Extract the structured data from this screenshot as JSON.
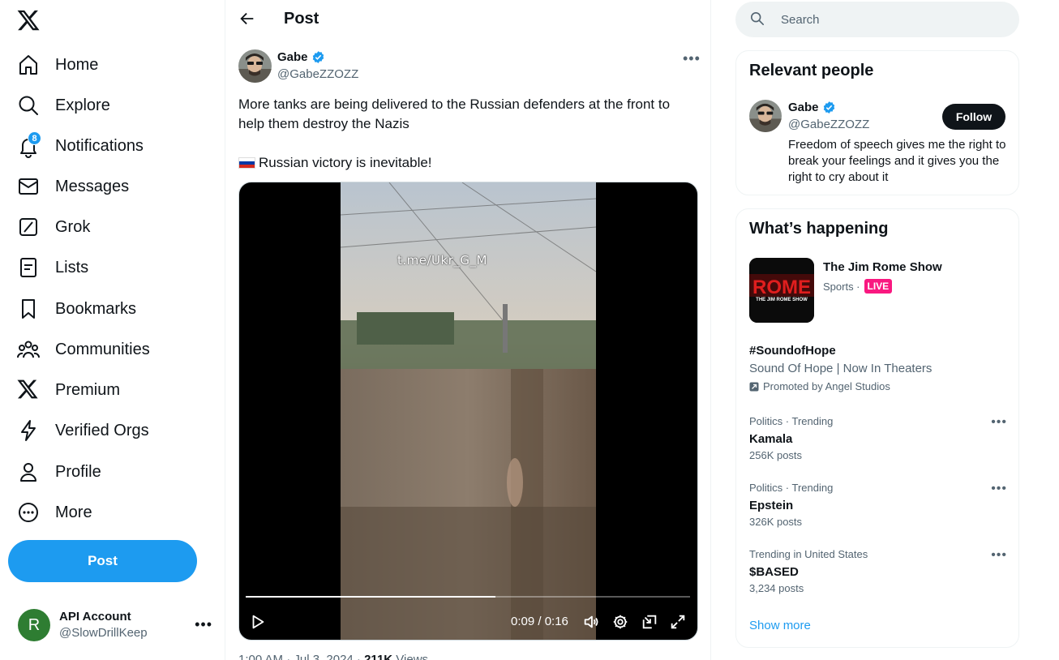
{
  "nav": {
    "logo": "x-logo-icon",
    "items": [
      {
        "label": "Home",
        "icon": "home-icon"
      },
      {
        "label": "Explore",
        "icon": "search-icon"
      },
      {
        "label": "Notifications",
        "icon": "bell-icon",
        "badge": "8"
      },
      {
        "label": "Messages",
        "icon": "mail-icon"
      },
      {
        "label": "Grok",
        "icon": "grok-icon"
      },
      {
        "label": "Lists",
        "icon": "list-icon"
      },
      {
        "label": "Bookmarks",
        "icon": "bookmark-icon"
      },
      {
        "label": "Communities",
        "icon": "people-icon"
      },
      {
        "label": "Premium",
        "icon": "x-logo-icon"
      },
      {
        "label": "Verified Orgs",
        "icon": "lightning-icon"
      },
      {
        "label": "Profile",
        "icon": "person-icon"
      },
      {
        "label": "More",
        "icon": "more-circle-icon"
      }
    ],
    "post_button": "Post",
    "account": {
      "avatar_letter": "R",
      "name": "API Account",
      "handle": "@SlowDrillKeep",
      "avatar_color": "#2e7d32"
    }
  },
  "main": {
    "header_title": "Post",
    "post": {
      "author_name": "Gabe",
      "author_handle": "@GabeZZOZZ",
      "text_line1": "More tanks are being delivered to the Russian defenders at the front to help them destroy the Nazis",
      "text_line2": "Russian victory is inevitable!",
      "video": {
        "watermark": "t.me/Ukr_G_M",
        "time": "0:09 / 0:16",
        "progress": 0.5625
      },
      "timestamp": "1:00 AM · Jul 3, 2024 · ",
      "views_count": "211K",
      "views_label": " Views"
    }
  },
  "right": {
    "search_placeholder": "Search",
    "relevant": {
      "title": "Relevant people",
      "name": "Gabe",
      "handle": "@GabeZZOZZ",
      "follow_label": "Follow",
      "bio": "Freedom of speech gives me the right to break your feelings and it gives you the right to cry about it"
    },
    "happening": {
      "title": "What’s happening",
      "show": {
        "title": "The Jim Rome Show",
        "category": "Sports ·",
        "live": "LIVE",
        "thumb_text": "ROME",
        "thumb_sub": "THE JIM ROME SHOW"
      },
      "promo": {
        "title": "#SoundofHope",
        "subtitle": "Sound Of Hope | Now In Theaters",
        "by": "Promoted by Angel Studios"
      },
      "trends": [
        {
          "category": "Politics · Trending",
          "name": "Kamala",
          "count": "256K posts"
        },
        {
          "category": "Politics · Trending",
          "name": "Epstein",
          "count": "326K posts"
        },
        {
          "category": "Trending in United States",
          "name": "$BASED",
          "count": "3,234 posts"
        }
      ],
      "show_more": "Show more"
    }
  },
  "colors": {
    "accent": "#1d9bf0",
    "text": "#0f1419",
    "muted": "#536471",
    "live": "#f91880"
  }
}
